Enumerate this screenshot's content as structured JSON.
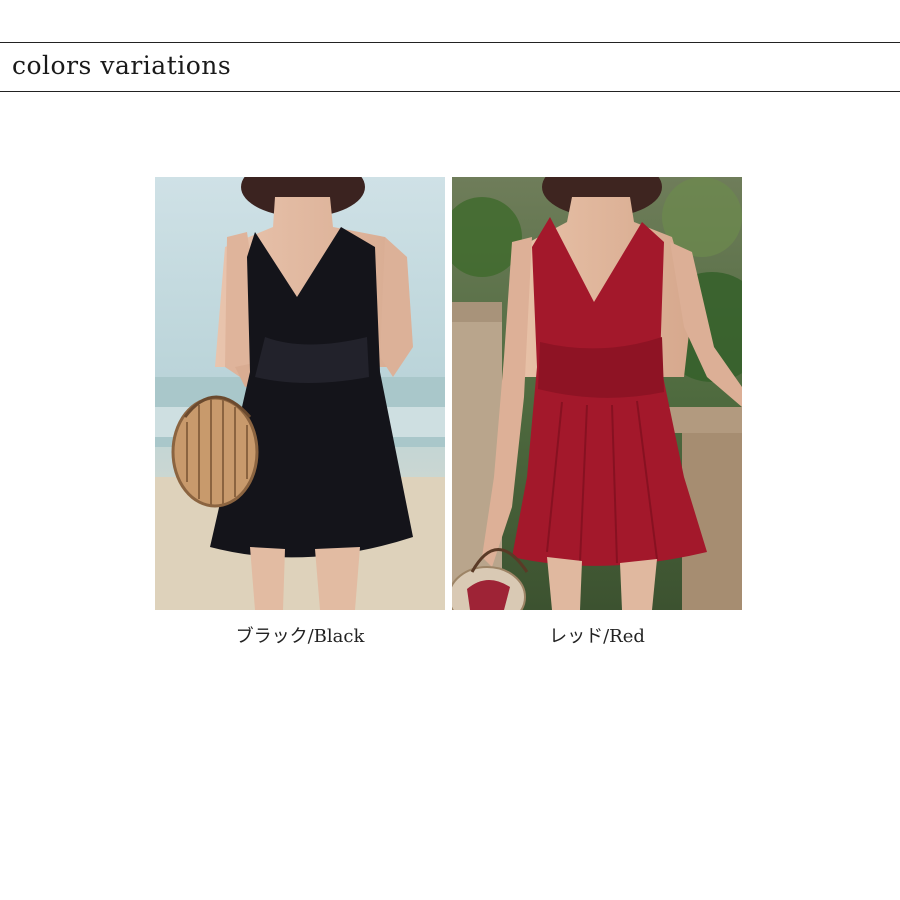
{
  "header": {
    "title": "colors variations"
  },
  "variants": [
    {
      "caption": "ブラック/Black",
      "dress_color": "#14141a",
      "background": "beach"
    },
    {
      "caption": "レッド/Red",
      "dress_color": "#a3182b",
      "background": "garden"
    }
  ],
  "colors": {
    "rule": "#222222",
    "text": "#1a1a1a"
  }
}
